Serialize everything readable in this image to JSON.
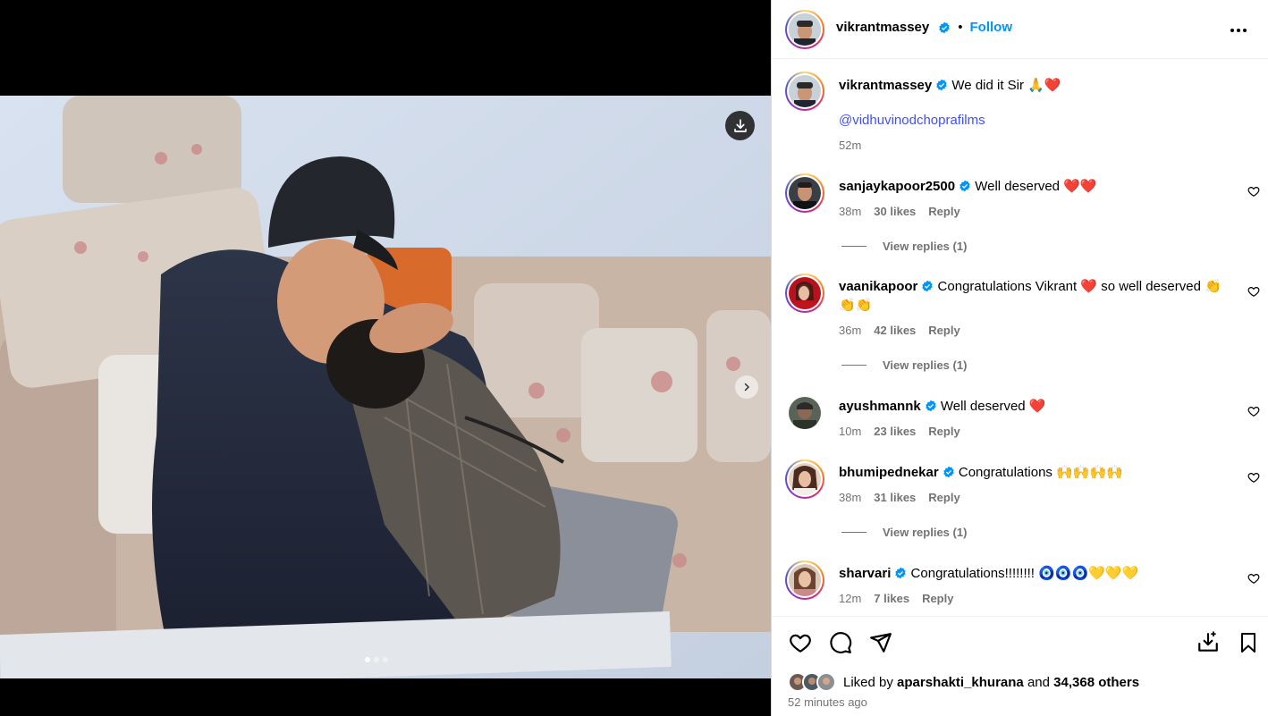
{
  "post": {
    "author": "vikrantmassey",
    "follow_label": "Follow",
    "separator": "•",
    "caption_text": "We did it Sir 🙏❤️",
    "caption_mention": "@vidhuvinodchoprafilms",
    "caption_time": "52m"
  },
  "comments": [
    {
      "user": "sanjaykapoor2500",
      "text": "Well deserved ❤️❤️",
      "time": "38m",
      "likes": "30 likes",
      "reply": "Reply",
      "view_replies": "View replies (1)"
    },
    {
      "user": "vaanikapoor",
      "text": "Congratulations Vikrant ❤️ so well deserved 👏👏👏",
      "time": "36m",
      "likes": "42 likes",
      "reply": "Reply",
      "view_replies": "View replies (1)"
    },
    {
      "user": "ayushmannk",
      "text": "Well deserved ❤️",
      "time": "10m",
      "likes": "23 likes",
      "reply": "Reply",
      "view_replies": ""
    },
    {
      "user": "bhumipednekar",
      "text": "Congratulations 🙌🙌🙌🙌",
      "time": "38m",
      "likes": "31 likes",
      "reply": "Reply",
      "view_replies": "View replies (1)"
    },
    {
      "user": "sharvari",
      "text": "Congratulations!!!!!!!! 🧿🧿🧿💛💛💛",
      "time": "12m",
      "likes": "7 likes",
      "reply": "Reply",
      "view_replies": ""
    }
  ],
  "footer": {
    "liked_by_prefix": "Liked by",
    "liked_by_user": "aparshakti_khurana",
    "liked_by_and": "and",
    "liked_by_others": "34,368 others",
    "time_ago": "52 minutes ago"
  },
  "icons": {
    "verified": "verified-badge-icon",
    "more": "more-options-icon",
    "download": "download-icon",
    "next": "chevron-right-icon",
    "like": "heart-icon",
    "comment": "comment-icon",
    "share": "share-icon",
    "save_to": "save-to-collection-icon",
    "bookmark": "bookmark-icon"
  },
  "colors": {
    "accent": "#0095f6",
    "mention": "#4150f7",
    "verified": "#0095f6",
    "muted": "#737373"
  },
  "carousel": {
    "current": 1,
    "total": 3
  }
}
